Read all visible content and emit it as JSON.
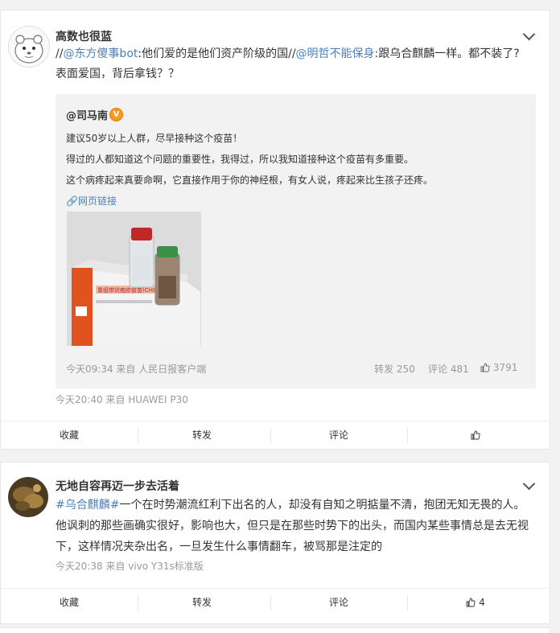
{
  "posts": [
    {
      "username": "高数也很蓝",
      "text": {
        "sep1": "//",
        "mention1": "@东方傻事bot",
        "part1": ":他们爱的是他们资产阶级的国//",
        "mention2": "@明哲不能保身",
        "part2": ":跟乌合麒麟一样。都不装了?",
        "line2": "表面爱国，背后拿钱？？"
      },
      "quote": {
        "author": "@司马南",
        "badge": "V",
        "lines": [
          "建议50岁以上人群，尽早接种这个疫苗！",
          "得过的人都知道这个问题的重要性，我得过，所以我知道接种这个疫苗有多重要。",
          "这个病疼起来真要命啊，它直接作用于你的神经根，有女人说，疼起来比生孩子还疼。"
        ],
        "weblink": "网页链接",
        "image_label": "重组带状疱疹疫苗(CHO细胞)",
        "meta": "今天09:34 来自 人民日报客户端",
        "repost": "转发 250",
        "comment": "评论 481",
        "like": "3791"
      },
      "meta": "今天20:40  来自 HUAWEI P30",
      "actions": {
        "fav": "收藏",
        "repost": "转发",
        "comment": "评论",
        "like": ""
      }
    },
    {
      "username": "无地自容再迈一步去活着",
      "text": {
        "hashtag": "#乌合麒麟#",
        "line1": "一个在时势潮流红利下出名的人，却没有自知之明掂量不清，抱团无知无畏的人。",
        "line2": "他讽刺的那些画确实很好，影响也大，但只是在那些时势下的出头，而国内某些事情总是去无视",
        "line3": "下，这样情况夹杂出名，一旦发生什么事情翻车，被骂那是注定的"
      },
      "meta": "今天20:38  来自 vivo Y31s标准版",
      "actions": {
        "fav": "收藏",
        "repost": "转发",
        "comment": "评论",
        "like": "4"
      }
    }
  ],
  "colors": {
    "link": "#4d7fb8",
    "accent": "#eb7350",
    "meta": "#999999"
  }
}
